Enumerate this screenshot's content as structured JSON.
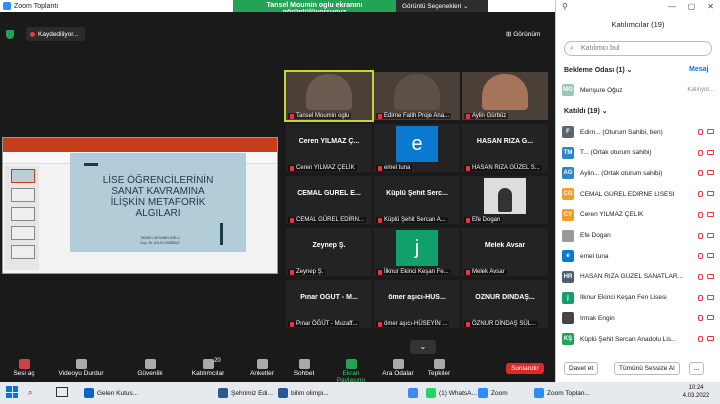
{
  "window": {
    "title": "Zoom Toplantı"
  },
  "share_banner": {
    "status": "Tansel Moumin oglu ekranını görüntülüyorsunuz",
    "options": "Görüntü Seçenekleri ⌄"
  },
  "top": {
    "recording": "Kaydediliyor...",
    "view": "⊞ Görünüm"
  },
  "slide": {
    "title": "LİSE ÖĞRENCİLERİNİN SANAT KAVRAMINA İLİŞKİN METAFORİK ALGILARI",
    "authors": "TANSEL MOUMIN OGLU",
    "advisor": "Doç. Dr. AYLİN GÜRBÜZ"
  },
  "tiles": [
    {
      "label": "Tansel Moumin oglu",
      "kind": "video",
      "color": "#6b5a4f",
      "active": true
    },
    {
      "label": "Edirne Fatih Proje Ana...",
      "kind": "video",
      "color": "#5b5147"
    },
    {
      "label": "Aylin Gürbüz",
      "kind": "video",
      "color": "#a6745b"
    },
    {
      "name": "Ceren YILMAZ Ç...",
      "label": "Ceren YILMAZ ÇELİK",
      "kind": "name"
    },
    {
      "label": "emel tuna",
      "kind": "avatar",
      "letter": "e",
      "color": "#0a7ad1"
    },
    {
      "name": "HASAN RIZA G...",
      "label": "HASAN RIZA GÜZEL S...",
      "kind": "name"
    },
    {
      "name": "CEMAL GÜREL E...",
      "label": "CEMAL GÜREL EDİRN...",
      "kind": "name"
    },
    {
      "name": "Küplü Şehit Serc...",
      "label": "Küplü Şehit Sercan A...",
      "kind": "name"
    },
    {
      "label": "Efe Dogan",
      "kind": "photo",
      "color": "#dddddd"
    },
    {
      "name": "Zeynep Ş.",
      "label": "Zeynep Ş.",
      "kind": "name"
    },
    {
      "label": "İlknur Ekinci Keşan Fe...",
      "kind": "avatar",
      "letter": "j",
      "color": "#12a06a"
    },
    {
      "name": "Melek Avsar",
      "label": "Melek Avsar",
      "kind": "name"
    },
    {
      "name": "Pınar ÖĞÜT - M...",
      "label": "Pınar ÖĞÜT - Muzaff...",
      "kind": "name"
    },
    {
      "name": "ömer aşıcı-HÜS...",
      "label": "ömer aşıcı-HÜSEYİN ...",
      "kind": "name"
    },
    {
      "name": "ÖZNUR DİNDAŞ...",
      "label": "ÖZNUR DİNDAŞ SÜL...",
      "kind": "name"
    }
  ],
  "toolbar": [
    {
      "label": "Sesi aç",
      "icon": "mic-icon"
    },
    {
      "label": "Videoyu Durdur",
      "icon": "video-icon"
    },
    {
      "label": "Güvenlik",
      "icon": "shield-icon"
    },
    {
      "label": "Katılımcılar",
      "icon": "participants-icon",
      "count": "20"
    },
    {
      "label": "Anketler",
      "icon": "poll-icon"
    },
    {
      "label": "Sohbet",
      "icon": "chat-icon"
    },
    {
      "label": "Ekran Paylaşımı",
      "icon": "share-icon"
    },
    {
      "label": "Ara Odalar",
      "icon": "rooms-icon"
    },
    {
      "label": "Tepkiler",
      "icon": "smile-icon"
    }
  ],
  "end_button": "Sonlandır",
  "panel": {
    "title": "Katılımcılar (19)",
    "search_placeholder": "Katılımcı bul",
    "waiting": "Bekleme Odası (1)",
    "message": "Mesaj",
    "waiting_person": {
      "initials": "MO",
      "name": "Menşure Oğuz",
      "status": "Katılıyor...",
      "color": "#9bc8b0"
    },
    "inroom": "Katıldı (19)",
    "people": [
      {
        "initials": "F",
        "name": "Edirn... (Oturum Sahibi, ben)",
        "color": "#5a6570"
      },
      {
        "initials": "TM",
        "name": "T... (Ortak oturum sahibi)",
        "color": "#2a86c8"
      },
      {
        "initials": "AG",
        "name": "Aylin... (Ortak oturum sahibi)",
        "color": "#2a86c8"
      },
      {
        "initials": "CG",
        "name": "CEMAL GÜREL EDİRNE LİSESİ",
        "color": "#f29c2b"
      },
      {
        "initials": "CY",
        "name": "Ceren YILMAZ ÇELİK",
        "color": "#f29c2b"
      },
      {
        "initials": "",
        "name": "Efe Dogan",
        "color": "#999999"
      },
      {
        "initials": "e",
        "name": "emel tuna",
        "color": "#0a7ad1"
      },
      {
        "initials": "HR",
        "name": "HASAN RIZA GÜZEL SANATLAR...",
        "color": "#4f5f73"
      },
      {
        "initials": "j",
        "name": "İlknur Ekinci Keşan Fen Lisesi",
        "color": "#12a06a"
      },
      {
        "initials": "",
        "name": "Irmak Engin",
        "color": "#444444"
      },
      {
        "initials": "KŞ",
        "name": "Küplü Şehit Sercan Anadolu Lis...",
        "color": "#23a455"
      }
    ],
    "invite": "Davet et",
    "mute_all": "Tümünü Sessize Al",
    "more": "..."
  },
  "taskbar": {
    "tasks": [
      {
        "label": "Gelen Kutus...",
        "color": "#0a64c8"
      },
      {
        "label": "Şehrimiz Edi...",
        "color": "#2b5797"
      },
      {
        "label": "bilim olimpi...",
        "color": "#2b5797"
      },
      {
        "label": "",
        "color": "#4285f4"
      },
      {
        "label": "(1) WhatsA...",
        "color": "#25d366"
      },
      {
        "label": "Zoom",
        "color": "#2d8cff"
      },
      {
        "label": "Zoom Toplan...",
        "color": "#2d8cff"
      }
    ],
    "time": "10:24",
    "date": "4.03.2022"
  }
}
